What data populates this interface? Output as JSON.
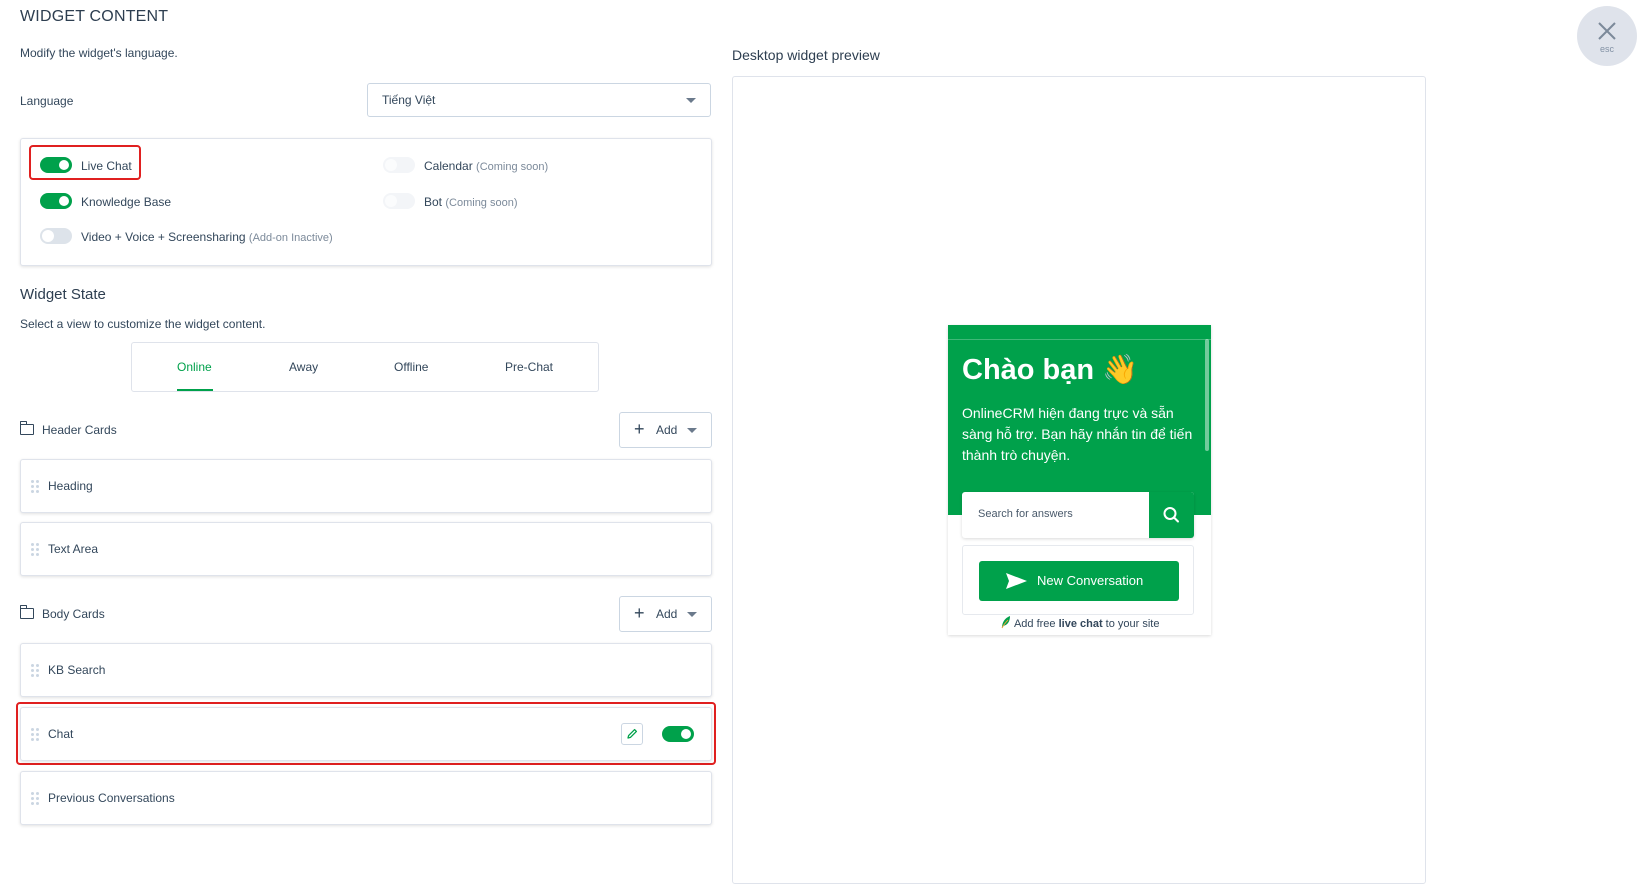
{
  "page": {
    "title": "WIDGET CONTENT",
    "subtitle": "Modify the widget's language.",
    "close_esc_label": "esc"
  },
  "language": {
    "label": "Language",
    "selected": "Tiếng Việt"
  },
  "features": {
    "live_chat": {
      "label": "Live Chat",
      "enabled": true
    },
    "knowledge_base": {
      "label": "Knowledge Base",
      "enabled": true
    },
    "video": {
      "label": "Video + Voice + Screensharing",
      "note": "(Add-on Inactive)",
      "enabled": false
    },
    "calendar": {
      "label": "Calendar",
      "note": "(Coming soon)",
      "enabled": false
    },
    "bot": {
      "label": "Bot",
      "note": "(Coming soon)",
      "enabled": false
    }
  },
  "widget_state": {
    "heading": "Widget State",
    "subtitle": "Select a view to customize the widget content.",
    "tabs": [
      "Online",
      "Away",
      "Offline",
      "Pre-Chat"
    ],
    "active_tab": "Online"
  },
  "header_cards": {
    "label": "Header Cards",
    "add_label": "Add",
    "items": [
      "Heading",
      "Text Area"
    ]
  },
  "body_cards": {
    "label": "Body Cards",
    "add_label": "Add",
    "items": [
      "KB Search",
      "Chat",
      "Previous Conversations"
    ],
    "chat_enabled": true
  },
  "preview": {
    "label": "Desktop widget preview",
    "greeting": "Chào bạn",
    "greeting_emoji": "👋",
    "message": "OnlineCRM hiện đang trực và sẵn sàng hỗ trợ. Bạn hãy nhắn tin để tiến thành trò chuyện.",
    "search_placeholder": "Search for answers",
    "cta_label": "New Conversation",
    "footer_prefix": "Add free ",
    "footer_bold": "live chat",
    "footer_suffix": " to your site"
  },
  "colors": {
    "brand_green": "#00a14b",
    "highlight_red": "#e02020",
    "text": "#33475b",
    "border": "#dfe3eb"
  }
}
